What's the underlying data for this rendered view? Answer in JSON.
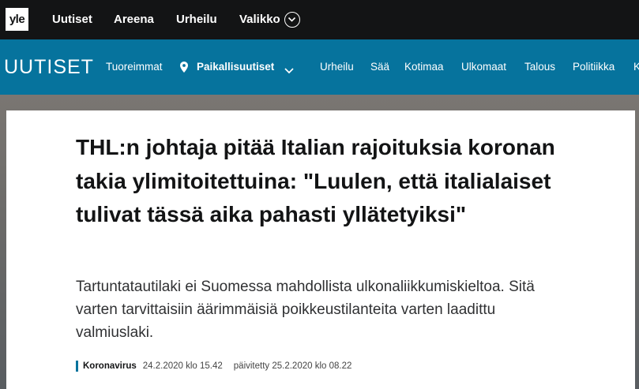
{
  "topbar": {
    "logo": "yle",
    "items": [
      "Uutiset",
      "Areena",
      "Urheilu",
      "Valikko"
    ]
  },
  "uutiset_bar": {
    "logo": "UUTISET",
    "tuoreimmat": "Tuoreimmat",
    "paikallis": "Paikallisuutiset",
    "items": [
      "Urheilu",
      "Sää",
      "Kotimaa",
      "Ulkomaat",
      "Talous",
      "Politiikka",
      "K"
    ]
  },
  "article": {
    "headline": "THL:n johtaja pitää Italian rajoituksia koronan takia ylimitoitettuina: \"Luulen, että italialaiset tulivat tässä aika pahasti yllätetyiksi\"",
    "lead": "Tartuntatautilaki ei Suomessa mahdollista ulkonaliikkumiskieltoa. Sitä varten tarvittaisiin äärimmäisiä poikkeustilanteita varten laadittu valmiuslaki.",
    "category": "Koronavirus",
    "published": "24.2.2020 klo 15.42",
    "updated": "päivitetty 25.2.2020 klo 08.22"
  },
  "colors": {
    "topbar_bg": "#131415",
    "brand_blue": "#06739d"
  },
  "icons": {
    "valikko": "chevron-down-circle-icon",
    "location": "location-pin-icon",
    "dropdown": "chevron-down-icon"
  }
}
